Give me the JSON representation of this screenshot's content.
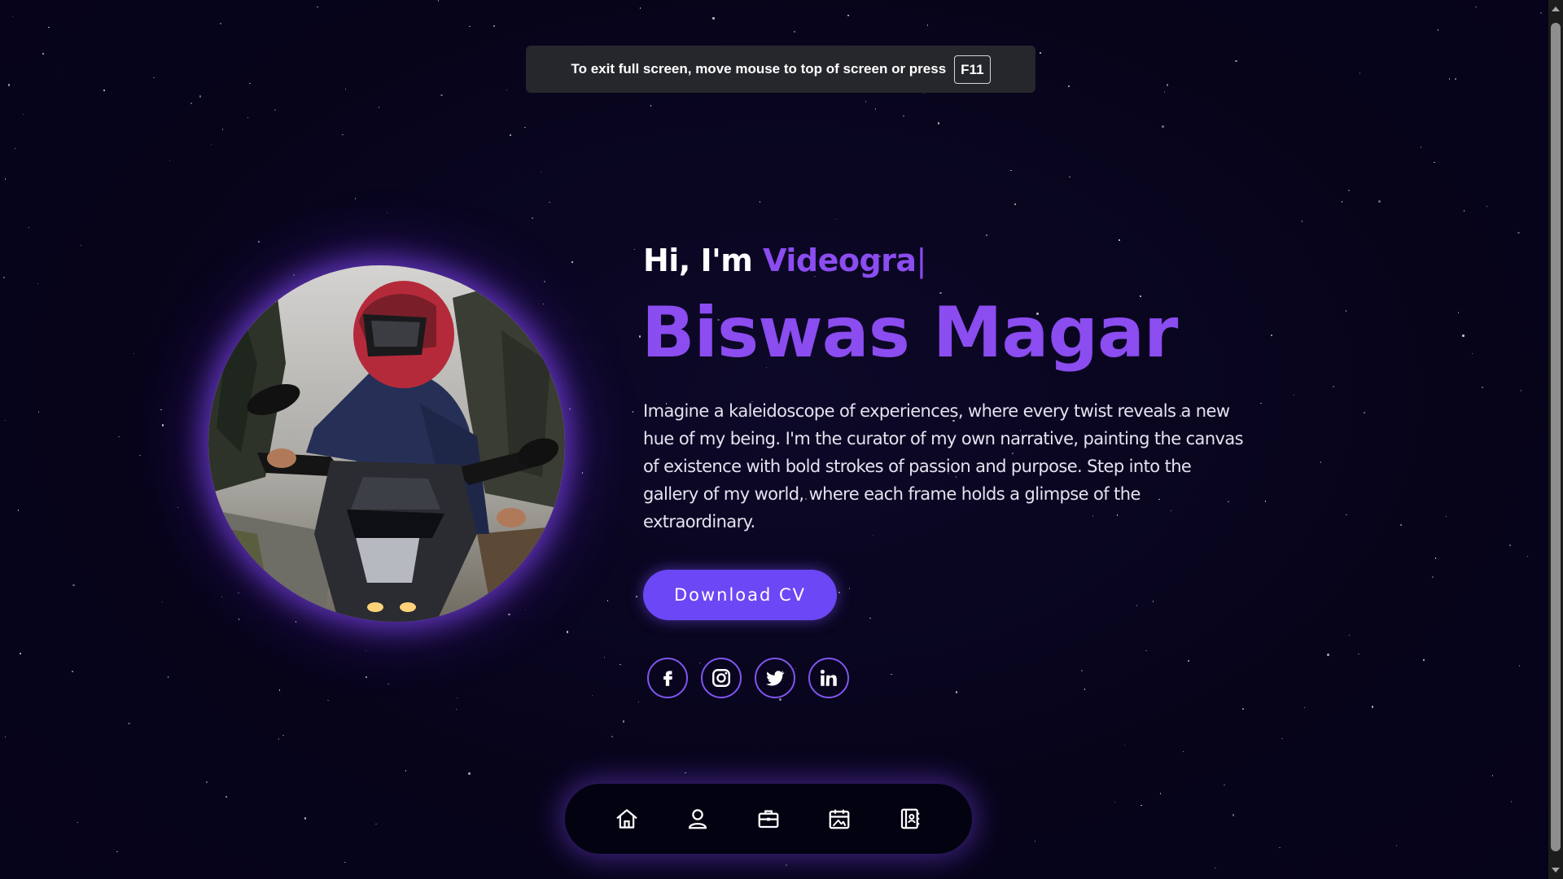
{
  "fullscreen_toast": {
    "message": "To exit full screen, move mouse to top of screen or press",
    "key": "F11"
  },
  "hero": {
    "greeting_prefix": "Hi, I'm",
    "typed_role": "Videogra",
    "caret": "|",
    "name": "Biswas Magar",
    "bio": "Imagine a kaleidoscope of experiences, where every twist reveals a new hue of my being. I'm the curator of my own narrative, painting the canvas of existence with bold strokes of passion and purpose. Step into the gallery of my world, where each frame holds a glimpse of the extraordinary.",
    "cta_label": "Download CV"
  },
  "socials": [
    {
      "icon": "facebook-icon"
    },
    {
      "icon": "instagram-icon"
    },
    {
      "icon": "twitter-icon"
    },
    {
      "icon": "linkedin-icon"
    }
  ],
  "nav": [
    {
      "icon": "home-icon"
    },
    {
      "icon": "user-icon"
    },
    {
      "icon": "briefcase-icon"
    },
    {
      "icon": "portfolio-icon"
    },
    {
      "icon": "contact-book-icon"
    }
  ],
  "colors": {
    "background": "#07041a",
    "accent": "#8b4cf0",
    "button": "#6c47f5",
    "text": "#e6e2ef"
  }
}
